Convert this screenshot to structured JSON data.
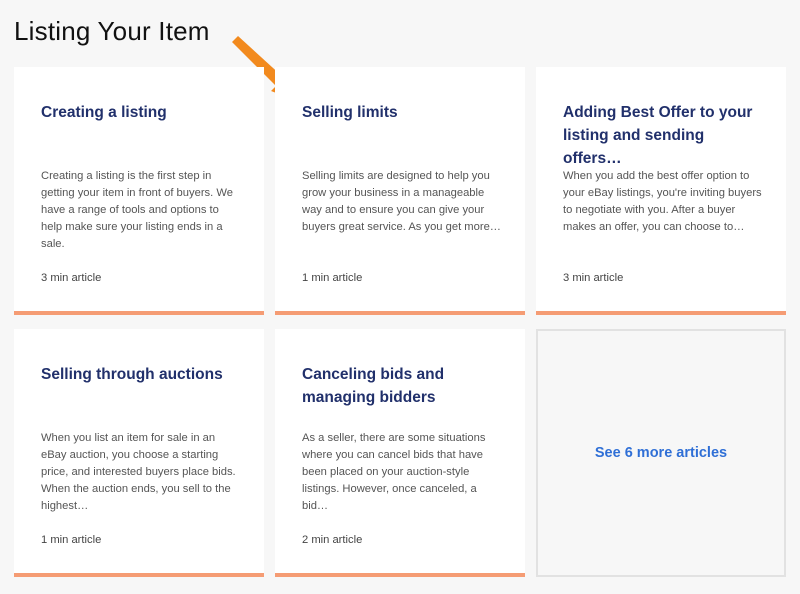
{
  "page": {
    "title": "Listing Your Item"
  },
  "cards": [
    {
      "title": "Creating a listing",
      "description": "Creating a listing is the first step in getting your item in front of buyers. We have a range of tools and options to help make sure your listing ends in a sale.",
      "meta": "3 min article"
    },
    {
      "title": "Selling limits",
      "description": "Selling limits are designed to help you grow your business in a manageable way and to ensure you can give your buyers great service. As you get more…",
      "meta": "1 min article"
    },
    {
      "title": "Adding Best Offer to your listing and sending offers…",
      "description": "When you add the best offer option to your eBay listings, you're inviting buyers to negotiate with you. After a buyer makes an offer, you can choose to…",
      "meta": "3 min article"
    },
    {
      "title": "Selling through auctions",
      "description": "When you list an item for sale in an eBay auction, you choose a starting price, and interested buyers place bids. When the auction ends, you sell to the highest…",
      "meta": "1 min article"
    },
    {
      "title": "Canceling bids and managing bidders",
      "description": "As a seller, there are some situations where you can cancel bids that have been placed on your auction-style listings. However, once canceled, a bid…",
      "meta": "2 min article"
    }
  ],
  "more": {
    "label": "See 6 more articles"
  },
  "colors": {
    "accent_border": "#f59c74",
    "title_navy": "#21306b",
    "link_blue": "#2f6fd6",
    "annotation_arrow": "#f28a1e"
  },
  "icons": {
    "annotation": "orange-arrow-icon"
  }
}
